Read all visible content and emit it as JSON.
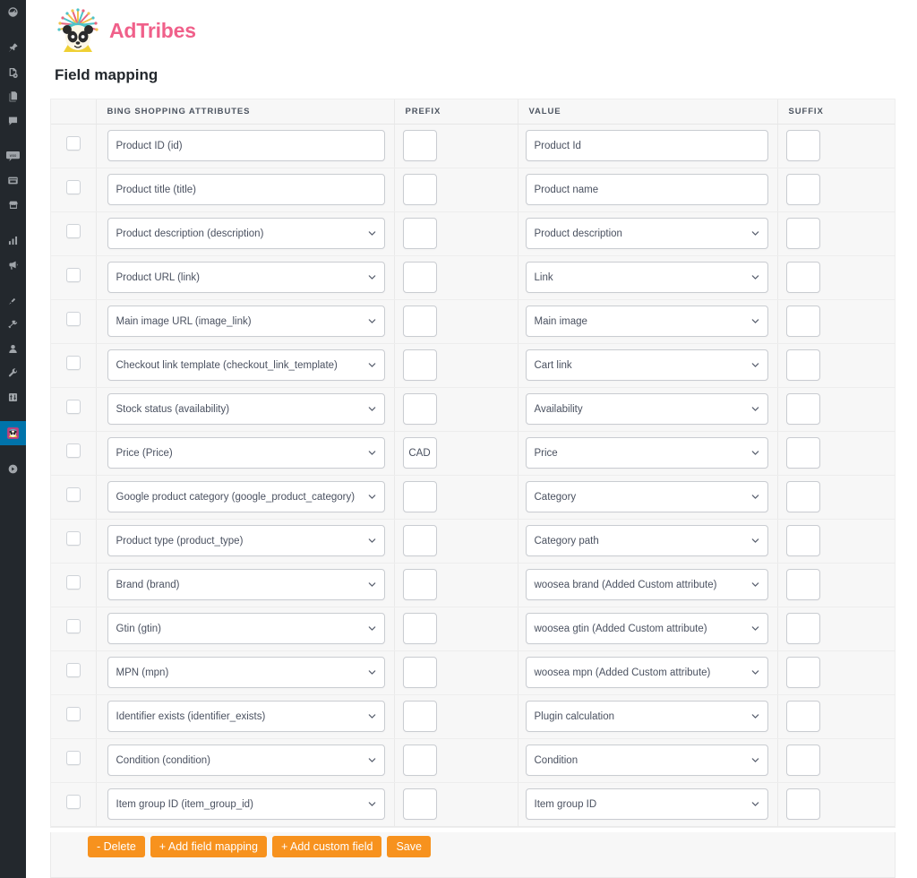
{
  "sidebar": {
    "background_color": "#23282d",
    "active_color": "#0073aa",
    "items": [
      {
        "name": "dashboard-icon",
        "label": "Dashboard",
        "active": false
      },
      {
        "name": "pin-icon",
        "label": "Posts",
        "active": false
      },
      {
        "name": "media-icon",
        "label": "Media",
        "active": false
      },
      {
        "name": "pages-icon",
        "label": "Pages",
        "active": false
      },
      {
        "name": "comments-icon",
        "label": "Comments",
        "active": false
      },
      {
        "name": "woo-icon",
        "label": "WooCommerce",
        "active": false
      },
      {
        "name": "products-icon",
        "label": "Products",
        "active": false
      },
      {
        "name": "store-icon",
        "label": "Store",
        "active": false
      },
      {
        "name": "analytics-icon",
        "label": "Analytics",
        "active": false
      },
      {
        "name": "marketing-icon",
        "label": "Marketing",
        "active": false
      },
      {
        "name": "appearance-icon",
        "label": "Appearance",
        "active": false
      },
      {
        "name": "plugins-icon",
        "label": "Plugins",
        "active": false
      },
      {
        "name": "users-icon",
        "label": "Users",
        "active": false
      },
      {
        "name": "tools-icon",
        "label": "Tools",
        "active": false
      },
      {
        "name": "settings-icon",
        "label": "Settings",
        "active": false
      },
      {
        "name": "adtribes-icon",
        "label": "AdTribes Product Feed",
        "active": true
      },
      {
        "name": "collapse-icon",
        "label": "Collapse menu",
        "active": false
      }
    ]
  },
  "brand": {
    "name": "AdTribes",
    "name_color": "#f0608a",
    "logo_icon": "panda-headdress-logo"
  },
  "page": {
    "title": "Field mapping"
  },
  "table": {
    "headers": {
      "checkbox": "",
      "attributes": "BING SHOPPING ATTRIBUTES",
      "prefix": "PREFIX",
      "value": "VALUE",
      "suffix": "SUFFIX"
    },
    "rows": [
      {
        "checked": false,
        "attribute": "Product ID (id)",
        "attribute_type": "text",
        "prefix": "",
        "value": "Product Id",
        "value_type": "text",
        "suffix": ""
      },
      {
        "checked": false,
        "attribute": "Product title (title)",
        "attribute_type": "text",
        "prefix": "",
        "value": "Product name",
        "value_type": "text",
        "suffix": ""
      },
      {
        "checked": false,
        "attribute": "Product description (description)",
        "attribute_type": "select",
        "prefix": "",
        "value": "Product description",
        "value_type": "select",
        "suffix": ""
      },
      {
        "checked": false,
        "attribute": "Product URL (link)",
        "attribute_type": "select",
        "prefix": "",
        "value": "Link",
        "value_type": "select",
        "suffix": ""
      },
      {
        "checked": false,
        "attribute": "Main image URL (image_link)",
        "attribute_type": "select",
        "prefix": "",
        "value": "Main image",
        "value_type": "select",
        "suffix": ""
      },
      {
        "checked": false,
        "attribute": "Checkout link template (checkout_link_template)",
        "attribute_type": "select",
        "prefix": "",
        "value": "Cart link",
        "value_type": "select",
        "suffix": ""
      },
      {
        "checked": false,
        "attribute": "Stock status (availability)",
        "attribute_type": "select",
        "prefix": "",
        "value": "Availability",
        "value_type": "select",
        "suffix": ""
      },
      {
        "checked": false,
        "attribute": "Price (Price)",
        "attribute_type": "select",
        "prefix": "CAD",
        "value": "Price",
        "value_type": "select",
        "suffix": ""
      },
      {
        "checked": false,
        "attribute": "Google product category (google_product_category)",
        "attribute_type": "select",
        "prefix": "",
        "value": "Category",
        "value_type": "select",
        "suffix": ""
      },
      {
        "checked": false,
        "attribute": "Product type (product_type)",
        "attribute_type": "select",
        "prefix": "",
        "value": "Category path",
        "value_type": "select",
        "suffix": ""
      },
      {
        "checked": false,
        "attribute": "Brand (brand)",
        "attribute_type": "select",
        "prefix": "",
        "value": "woosea brand (Added Custom attribute)",
        "value_type": "select",
        "suffix": ""
      },
      {
        "checked": false,
        "attribute": "Gtin (gtin)",
        "attribute_type": "select",
        "prefix": "",
        "value": "woosea gtin (Added Custom attribute)",
        "value_type": "select",
        "suffix": ""
      },
      {
        "checked": false,
        "attribute": "MPN (mpn)",
        "attribute_type": "select",
        "prefix": "",
        "value": "woosea mpn (Added Custom attribute)",
        "value_type": "select",
        "suffix": ""
      },
      {
        "checked": false,
        "attribute": "Identifier exists (identifier_exists)",
        "attribute_type": "select",
        "prefix": "",
        "value": "Plugin calculation",
        "value_type": "select",
        "suffix": ""
      },
      {
        "checked": false,
        "attribute": "Condition (condition)",
        "attribute_type": "select",
        "prefix": "",
        "value": "Condition",
        "value_type": "select",
        "suffix": ""
      },
      {
        "checked": false,
        "attribute": "Item group ID (item_group_id)",
        "attribute_type": "select",
        "prefix": "",
        "value": "Item group ID",
        "value_type": "select",
        "suffix": ""
      }
    ]
  },
  "buttons": {
    "color": "#f7921e",
    "items": [
      {
        "name": "delete-button",
        "label": "- Delete"
      },
      {
        "name": "add-field-mapping-button",
        "label": "+ Add field mapping"
      },
      {
        "name": "add-custom-field-button",
        "label": "+ Add custom field"
      },
      {
        "name": "save-button",
        "label": "Save"
      }
    ]
  }
}
